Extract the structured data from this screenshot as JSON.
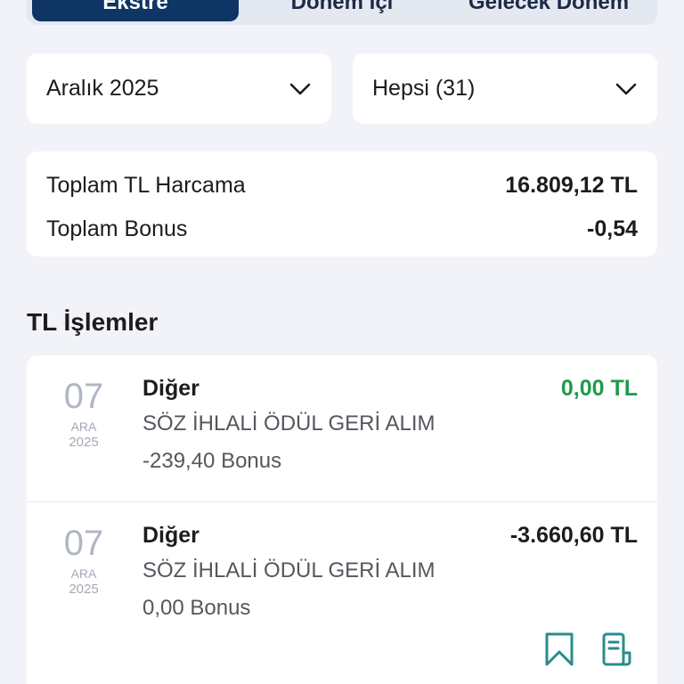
{
  "tabs": [
    {
      "label": "Ekstre",
      "active": true
    },
    {
      "label": "Dönem İçi",
      "active": false
    },
    {
      "label": "Gelecek Dönem",
      "active": false
    }
  ],
  "filters": {
    "period": {
      "value": "Aralık 2025",
      "icon": "chevron-down-icon"
    },
    "type": {
      "value": "Hepsi (31)",
      "icon": "chevron-down-icon"
    }
  },
  "summary": {
    "total_label": "Toplam TL Harcama",
    "total_value": "16.809,12 TL",
    "bonus_label": "Toplam Bonus",
    "bonus_value": "-0,54"
  },
  "section_title": "TL İşlemler",
  "transactions": [
    {
      "day": "07",
      "month": "ARA",
      "year": "2025",
      "category": "Diğer",
      "description": "SÖZ İHLALİ ÖDÜL GERİ ALIM",
      "bonus": "-239,40 Bonus",
      "amount": "0,00 TL",
      "amount_color": "#1f9a4b"
    },
    {
      "day": "07",
      "month": "ARA",
      "year": "2025",
      "category": "Diğer",
      "description": "SÖZ İHLALİ ÖDÜL GERİ ALIM",
      "bonus": "0,00 Bonus",
      "amount": "-3.660,60 TL",
      "amount_color": "#1c1c1e",
      "actions": [
        "bookmark-icon",
        "receipt-icon"
      ]
    }
  ],
  "colors": {
    "accent": "#0f3564",
    "icon_teal": "#2a8c8c",
    "positive": "#1f9a4b",
    "background": "#f2f3f8"
  }
}
